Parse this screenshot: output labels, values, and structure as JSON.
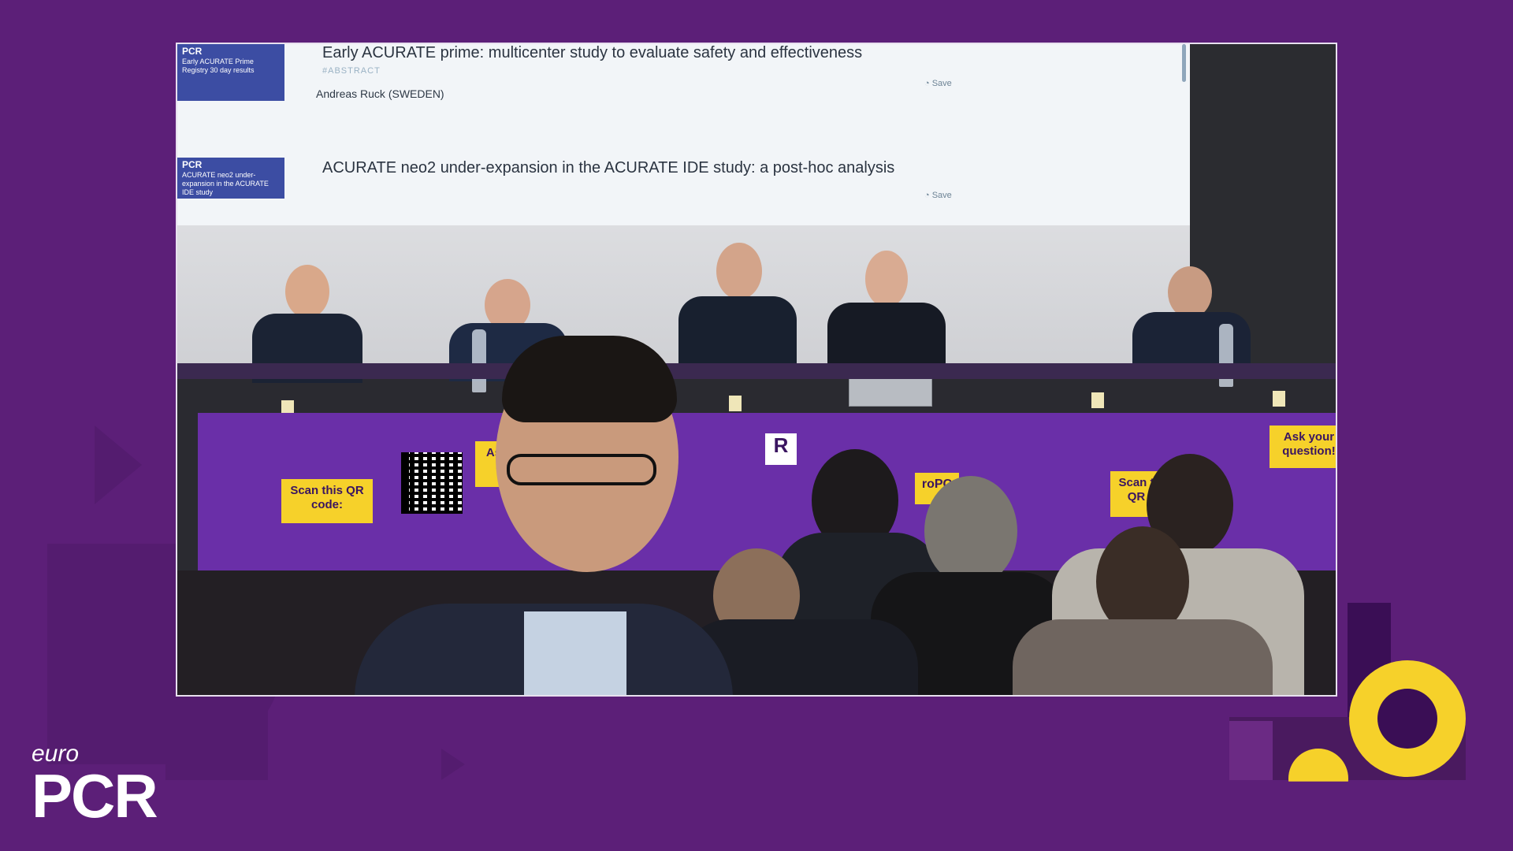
{
  "screen": {
    "items": [
      {
        "title": "Early ACURATE prime: multicenter study to evaluate safety and effectiveness",
        "tag": "#ABSTRACT",
        "speaker": "Andreas Ruck  (SWEDEN)",
        "save_label": "Save",
        "thumb_brand": "PCR",
        "thumb_text": "Early ACURATE Prime Registry 30 day results"
      },
      {
        "title": "ACURATE neo2 under-expansion in the ACURATE IDE study: a post-hoc analysis",
        "save_label": "Save",
        "thumb_brand": "PCR",
        "thumb_text": "ACURATE neo2 under-expansion in the ACURATE IDE study"
      }
    ]
  },
  "banner": {
    "scan_label": "Scan this QR code:",
    "ask_label": "Ask your question!",
    "scan_label_partial": "Scan t QR",
    "ask_label_partial": "Ask your quest",
    "brand_partial": "roPC",
    "brand_partial_2": "R"
  },
  "logo": {
    "euro": "euro",
    "pcr": "PCR"
  },
  "colors": {
    "background": "#5c1f78",
    "banner": "#6a2fa8",
    "accent_yellow": "#f6d12a",
    "frame": "#e8e0ef"
  }
}
